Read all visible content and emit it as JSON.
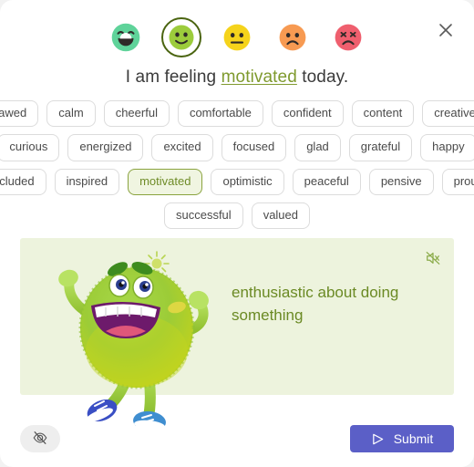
{
  "dialog": {
    "close_label": "Close",
    "close_icon": "close-icon"
  },
  "mood_scale": {
    "options": [
      {
        "id": "very-happy",
        "icon": "emoji-grinning-face",
        "color": "#5fd39a",
        "selected": false
      },
      {
        "id": "happy",
        "icon": "emoji-smiling-face",
        "color": "#9ccc3c",
        "selected": true
      },
      {
        "id": "neutral",
        "icon": "emoji-neutral-face",
        "color": "#f5d31b",
        "selected": false
      },
      {
        "id": "sad",
        "icon": "emoji-frowning-face",
        "color": "#f79a52",
        "selected": false
      },
      {
        "id": "angry",
        "icon": "emoji-angry-face",
        "color": "#ef5f6e",
        "selected": false
      }
    ]
  },
  "headline": {
    "prefix": "I am feeling ",
    "highlight": "motivated",
    "suffix": " today."
  },
  "feelings": {
    "rows": [
      [
        "awed",
        "calm",
        "cheerful",
        "comfortable",
        "confident",
        "content",
        "creative"
      ],
      [
        "curious",
        "energized",
        "excited",
        "focused",
        "glad",
        "grateful",
        "happy"
      ],
      [
        "included",
        "inspired",
        "motivated",
        "optimistic",
        "peaceful",
        "pensive",
        "proud"
      ],
      [
        "successful",
        "valued"
      ]
    ],
    "selected": "motivated"
  },
  "definition_panel": {
    "text": "enthusiastic about doing something",
    "mute_icon": "speaker-muted-icon",
    "mute_label": "Mute",
    "background_color": "#edf3dd",
    "text_color": "#6b8a24",
    "mascot_icon": "green-monster-mascot"
  },
  "footer": {
    "hide_icon": "eye-off-icon",
    "hide_label": "Hide",
    "submit_label": "Submit",
    "submit_icon": "send-icon",
    "submit_color": "#5b5fc7"
  }
}
